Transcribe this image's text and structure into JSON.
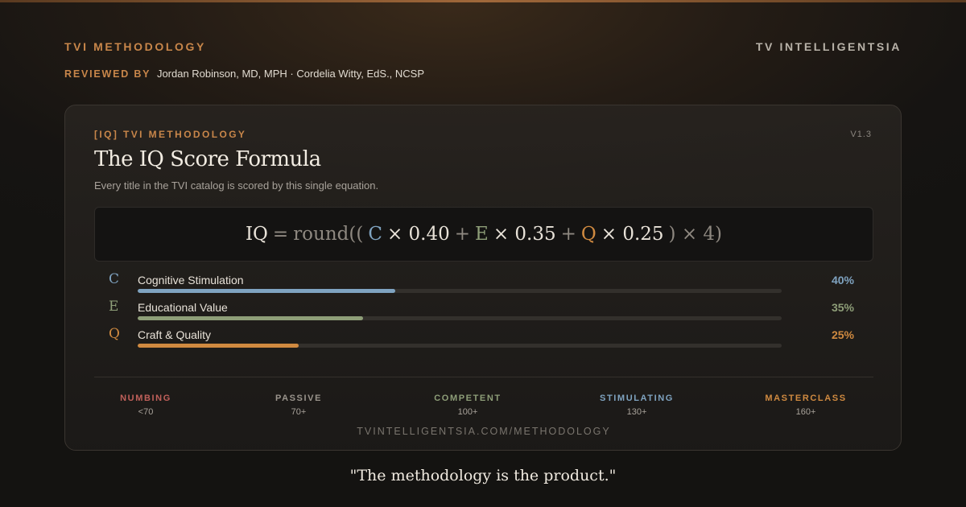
{
  "header": {
    "brand_left": "TVI METHODOLOGY",
    "brand_right": "TV INTELLIGENTSIA",
    "reviewed_label": "REVIEWED BY",
    "reviewers": "Jordan Robinson, MD, MPH · Cordelia Witty, EdS., NCSP"
  },
  "card": {
    "eyebrow": "[IQ] TVI METHODOLOGY",
    "version": "V1.3",
    "title": "The IQ Score Formula",
    "subtitle": "Every title in the TVI catalog is scored by this single equation.",
    "formula": {
      "iq": "IQ",
      "eq": "=",
      "fn": "round((",
      "c": "C",
      "c_weight": "× 0.40",
      "plus1": "+",
      "e": "E",
      "e_weight": "× 0.35",
      "plus2": "+",
      "q": "Q",
      "q_weight": "× 0.25",
      "tail": ") × 4)"
    },
    "components": [
      {
        "letter": "C",
        "label": "Cognitive Stimulation",
        "percent_text": "40%",
        "weight": 0.4,
        "color": "#7fa3c0"
      },
      {
        "letter": "E",
        "label": "Educational Value",
        "percent_text": "35%",
        "weight": 0.35,
        "color": "#8e9e78"
      },
      {
        "letter": "Q",
        "label": "Craft & Quality",
        "percent_text": "25%",
        "weight": 0.25,
        "color": "#d08a40"
      }
    ],
    "tiers": [
      {
        "name": "NUMBING",
        "range": "<70",
        "color": "#c0605a"
      },
      {
        "name": "PASSIVE",
        "range": "70+",
        "color": "#9a948c"
      },
      {
        "name": "COMPETENT",
        "range": "100+",
        "color": "#8e9e78"
      },
      {
        "name": "STIMULATING",
        "range": "130+",
        "color": "#7fa3c0"
      },
      {
        "name": "MASTERCLASS",
        "range": "160+",
        "color": "#d08a40"
      }
    ],
    "site": "TVINTELLIGENTSIA.COM/METHODOLOGY"
  },
  "quote": "\"The methodology is the product.\""
}
